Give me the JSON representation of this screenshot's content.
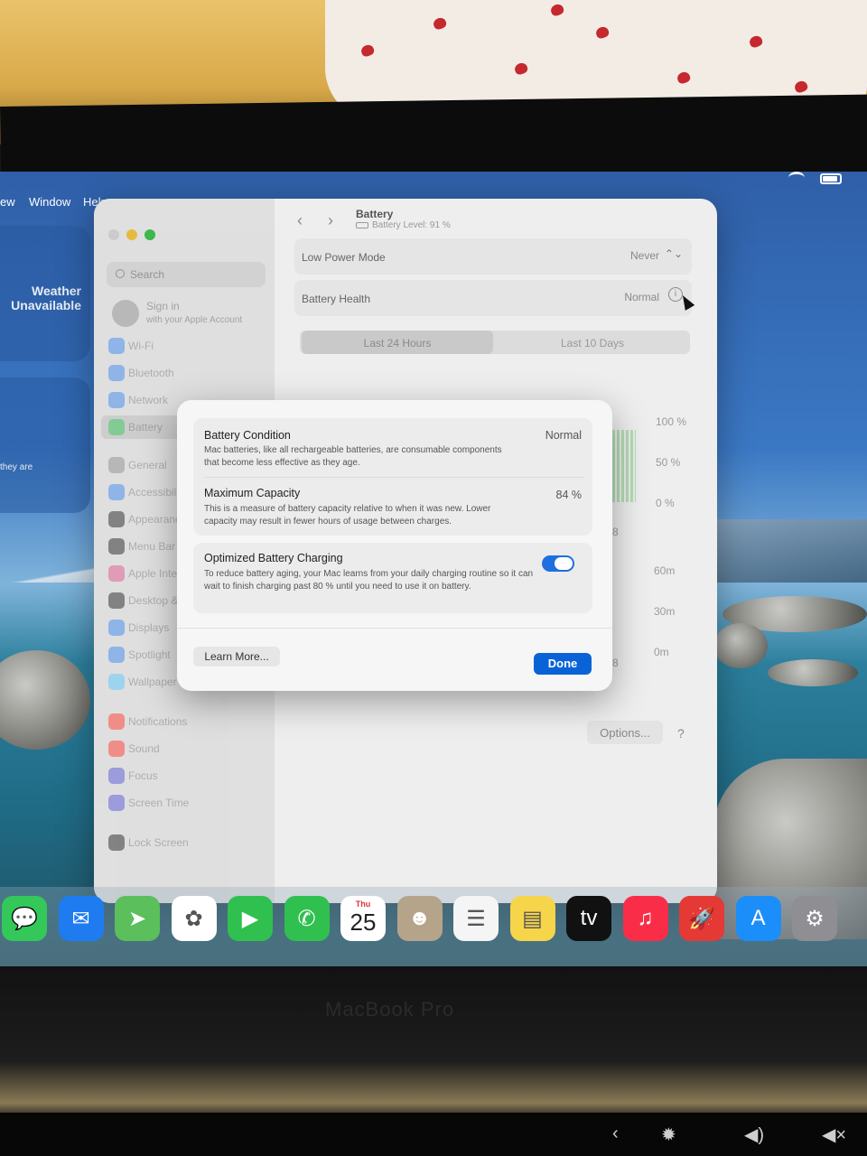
{
  "menubar": {
    "items": [
      "ew",
      "Window",
      "Help"
    ]
  },
  "widgets": {
    "weather_title": "Weather Unavailable",
    "partial_text": "they are"
  },
  "window": {
    "title": "Battery",
    "battery_level": "Battery Level: 91 %",
    "search": {
      "placeholder": "Search"
    },
    "account": {
      "title": "Sign in",
      "subtitle": "with your Apple Account"
    },
    "sidebar": [
      {
        "label": "Wi-Fi",
        "icon": "wifi-icon",
        "color": "#3a86f0"
      },
      {
        "label": "Bluetooth",
        "icon": "bluetooth-icon",
        "color": "#3a86f0"
      },
      {
        "label": "Network",
        "icon": "globe-icon",
        "color": "#3a86f0"
      },
      {
        "label": "Battery",
        "icon": "battery-icon",
        "color": "#34c759",
        "active": true
      },
      {
        "label": "General",
        "icon": "gear-icon",
        "color": "#8e8e93"
      },
      {
        "label": "Accessibil",
        "icon": "accessibility-icon",
        "color": "#3a86f0"
      },
      {
        "label": "Appearanc",
        "icon": "appearance-icon",
        "color": "#222222"
      },
      {
        "label": "Menu Bar",
        "icon": "menubar-icon",
        "color": "#222222"
      },
      {
        "label": "Apple Inte",
        "icon": "siri-icon",
        "color": "#e0558a"
      },
      {
        "label": "Desktop &",
        "icon": "desktop-icon",
        "color": "#222222"
      },
      {
        "label": "Displays",
        "icon": "sun-icon",
        "color": "#3a86f0"
      },
      {
        "label": "Spotlight",
        "icon": "search-icon",
        "color": "#3a86f0"
      },
      {
        "label": "Wallpaper",
        "icon": "wallpaper-icon",
        "color": "#5ac8fa"
      },
      {
        "label": "Notifications",
        "icon": "bell-icon",
        "color": "#ff3b30"
      },
      {
        "label": "Sound",
        "icon": "speaker-icon",
        "color": "#ff3b30"
      },
      {
        "label": "Focus",
        "icon": "moon-icon",
        "color": "#5856d6"
      },
      {
        "label": "Screen Time",
        "icon": "hourglass-icon",
        "color": "#5856d6"
      },
      {
        "label": "Lock Screen",
        "icon": "lock-icon",
        "color": "#222222"
      }
    ],
    "low_power": {
      "label": "Low Power Mode",
      "value": "Never"
    },
    "battery_health": {
      "label": "Battery Health",
      "value": "Normal"
    },
    "segments": [
      "Last 24 Hours",
      "Last 10 Days"
    ],
    "axis_right": [
      "100 %",
      "50 %",
      "0 %",
      "60m",
      "30m",
      "0m"
    ],
    "axis_partial": [
      "8",
      "8"
    ],
    "options_label": "Options...",
    "help_label": "?"
  },
  "dialog": {
    "condition": {
      "title": "Battery Condition",
      "value": "Normal",
      "desc": "Mac batteries, like all rechargeable batteries, are consumable components that become less effective as they age."
    },
    "capacity": {
      "title": "Maximum Capacity",
      "value": "84 %",
      "desc": "This is a measure of battery capacity relative to when it was new. Lower capacity may result in fewer hours of usage between charges."
    },
    "optimized": {
      "title": "Optimized Battery Charging",
      "enabled": true,
      "desc": "To reduce battery aging, your Mac learns from your daily charging routine so it can wait to finish charging past 80 % until you need to use it on battery."
    },
    "learn_more": "Learn More...",
    "done": "Done"
  },
  "dock": {
    "calendar": {
      "day": "Thu",
      "date": "25"
    },
    "apps": [
      {
        "name": "messages-icon",
        "glyph": "💬",
        "color": "#34c759"
      },
      {
        "name": "mail-icon",
        "glyph": "✉",
        "color": "#1e7cf0"
      },
      {
        "name": "maps-icon",
        "glyph": "➤",
        "color": "#5bbf5b"
      },
      {
        "name": "photos-icon",
        "glyph": "✿",
        "color": "#ffffff"
      },
      {
        "name": "facetime-icon",
        "glyph": "▶",
        "color": "#30c04f"
      },
      {
        "name": "phone-icon",
        "glyph": "✆",
        "color": "#30c04f"
      },
      {
        "name": "calendar-icon",
        "glyph": "",
        "color": "#ffffff"
      },
      {
        "name": "contacts-icon",
        "glyph": "☻",
        "color": "#b6a48a"
      },
      {
        "name": "reminders-icon",
        "glyph": "☰",
        "color": "#f5f5f5"
      },
      {
        "name": "notes-icon",
        "glyph": "▤",
        "color": "#f7d54a"
      },
      {
        "name": "appletv-icon",
        "glyph": "tv",
        "color": "#111111"
      },
      {
        "name": "music-icon",
        "glyph": "♫",
        "color": "#fa2d48"
      },
      {
        "name": "rocket-icon",
        "glyph": "🚀",
        "color": "#e53935"
      },
      {
        "name": "appstore-icon",
        "glyph": "A",
        "color": "#1c8ef9"
      },
      {
        "name": "system-settings-icon",
        "glyph": "⚙",
        "color": "#8e8e93"
      }
    ]
  },
  "hardware": {
    "brand": "MacBook Pro"
  }
}
